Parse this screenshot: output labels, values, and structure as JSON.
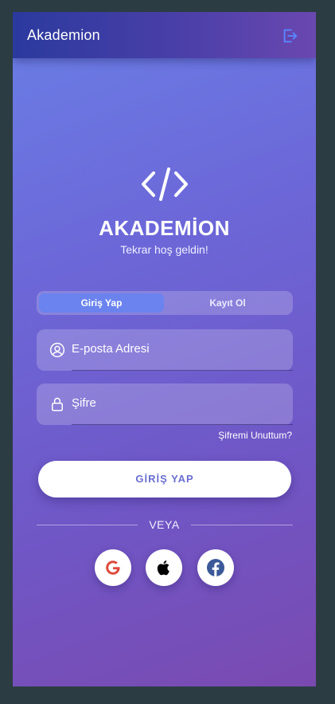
{
  "appbar": {
    "title": "Akademion",
    "logout_icon": "logout-icon"
  },
  "hero": {
    "icon": "code-icon",
    "brand": "AKADEMİON",
    "tagline": "Tekrar hoş geldin!"
  },
  "tabs": [
    {
      "label": "Giriş Yap",
      "active": true
    },
    {
      "label": "Kayıt Ol",
      "active": false
    }
  ],
  "form": {
    "email": {
      "placeholder": "E-posta Adresi",
      "icon": "user-icon"
    },
    "password": {
      "placeholder": "Şifre",
      "icon": "lock-icon"
    },
    "forgot_label": "Şifremi Unuttum?",
    "submit_label": "GİRİŞ YAP"
  },
  "divider_label": "VEYA",
  "social": [
    {
      "name": "google",
      "icon": "google-icon"
    },
    {
      "name": "apple",
      "icon": "apple-icon"
    },
    {
      "name": "facebook",
      "icon": "facebook-icon"
    }
  ],
  "colors": {
    "accent": "#6a83ee",
    "appbar": "#2b3a9e",
    "background": "#2b3d42"
  }
}
